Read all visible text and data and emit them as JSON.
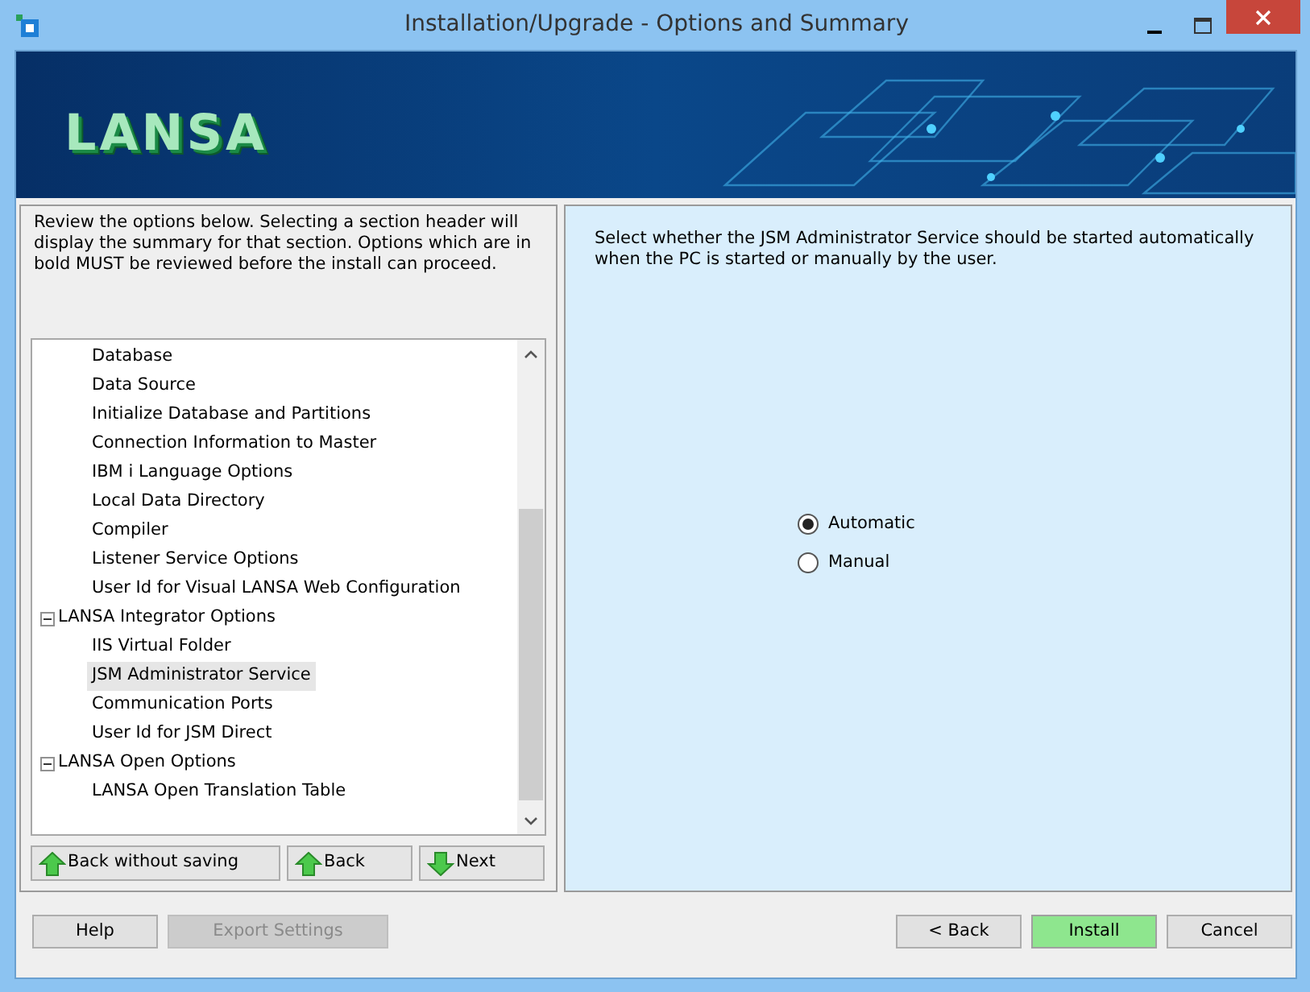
{
  "window": {
    "title": "Installation/Upgrade - Options and Summary"
  },
  "banner": {
    "logo": "LANSA"
  },
  "intro": "Review the options below. Selecting a section header will display the summary for that section. Options which are in bold MUST be reviewed before the install can proceed.",
  "tree": [
    {
      "children": [
        {
          "label": "Database",
          "selected": false
        },
        {
          "label": "Data Source",
          "selected": false
        },
        {
          "label": "Initialize Database and Partitions",
          "selected": false
        },
        {
          "label": "Connection Information to Master",
          "selected": false
        },
        {
          "label": "IBM i Language Options",
          "selected": false
        },
        {
          "label": "Local Data Directory",
          "selected": false
        },
        {
          "label": "Compiler",
          "selected": false
        },
        {
          "label": "Listener Service Options",
          "selected": false
        },
        {
          "label": "User Id for Visual LANSA Web Configuration",
          "selected": false
        }
      ]
    },
    {
      "label": "LANSA Integrator Options",
      "expanded": true,
      "selected": false,
      "children": [
        {
          "label": "IIS Virtual Folder",
          "selected": false
        },
        {
          "label": "JSM Administrator Service",
          "selected": true
        },
        {
          "label": "Communication Ports",
          "selected": false
        },
        {
          "label": "User Id for JSM Direct",
          "selected": false
        }
      ]
    },
    {
      "label": "LANSA Open Options",
      "expanded": true,
      "selected": false,
      "children": [
        {
          "label": "LANSA Open Translation Table",
          "selected": false
        }
      ]
    }
  ],
  "nav_buttons": [
    {
      "label": "Back without saving",
      "kind": "up"
    },
    {
      "label": "Back",
      "kind": "up"
    },
    {
      "label": "Next",
      "kind": "down"
    }
  ],
  "detail": {
    "description": "Select whether the JSM Administrator Service should be started automatically when the PC is started or manually by the user.",
    "options": [
      {
        "label": "Automatic",
        "selected": true
      },
      {
        "label": "Manual",
        "selected": false
      }
    ]
  },
  "footer_left": [
    {
      "label": "Help",
      "disabled": false
    },
    {
      "label": "Export Settings",
      "disabled": true
    }
  ],
  "footer_right": [
    {
      "label": "< Back",
      "highlighted": false
    },
    {
      "label": "Install",
      "highlighted": true
    },
    {
      "label": "Cancel",
      "highlighted": false
    }
  ]
}
